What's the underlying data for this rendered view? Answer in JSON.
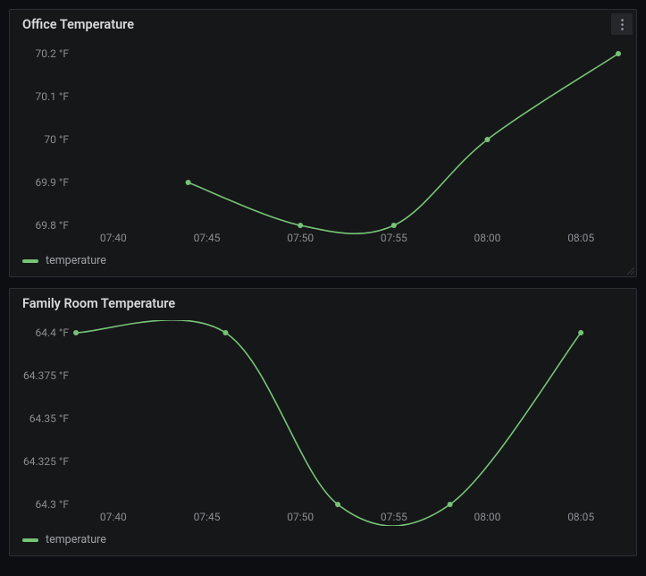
{
  "panels": [
    {
      "title": "Office Temperature",
      "legend": "temperature",
      "has_menu": true
    },
    {
      "title": "Family Room Temperature",
      "legend": "temperature",
      "has_menu": false
    }
  ],
  "colors": {
    "series": "#77c377",
    "panel_bg": "#161719",
    "page_bg": "#0d0e11",
    "border": "#2c2f34",
    "tick_text": "#8a8d92"
  },
  "chart_data": [
    {
      "type": "line",
      "title": "Office Temperature",
      "xlabel": "",
      "ylabel": "",
      "x_ticks": [
        "07:40",
        "07:45",
        "07:50",
        "07:55",
        "08:00",
        "08:05"
      ],
      "y_ticks": [
        "69.8 °F",
        "69.9 °F",
        "70 °F",
        "70.1 °F",
        "70.2 °F"
      ],
      "ylim": [
        69.8,
        70.2
      ],
      "series": [
        {
          "name": "temperature",
          "x": [
            "07:44",
            "07:50",
            "07:55",
            "08:00",
            "08:07"
          ],
          "values": [
            69.9,
            69.8,
            69.8,
            70.0,
            70.2
          ]
        }
      ]
    },
    {
      "type": "line",
      "title": "Family Room Temperature",
      "xlabel": "",
      "ylabel": "",
      "x_ticks": [
        "07:40",
        "07:45",
        "07:50",
        "07:55",
        "08:00",
        "08:05"
      ],
      "y_ticks": [
        "64.3 °F",
        "64.325 °F",
        "64.35 °F",
        "64.375 °F",
        "64.4 °F"
      ],
      "ylim": [
        64.3,
        64.4
      ],
      "series": [
        {
          "name": "temperature",
          "x": [
            "07:38",
            "07:46",
            "07:52",
            "07:58",
            "08:05"
          ],
          "values": [
            64.4,
            64.4,
            64.3,
            64.3,
            64.4
          ]
        }
      ]
    }
  ]
}
